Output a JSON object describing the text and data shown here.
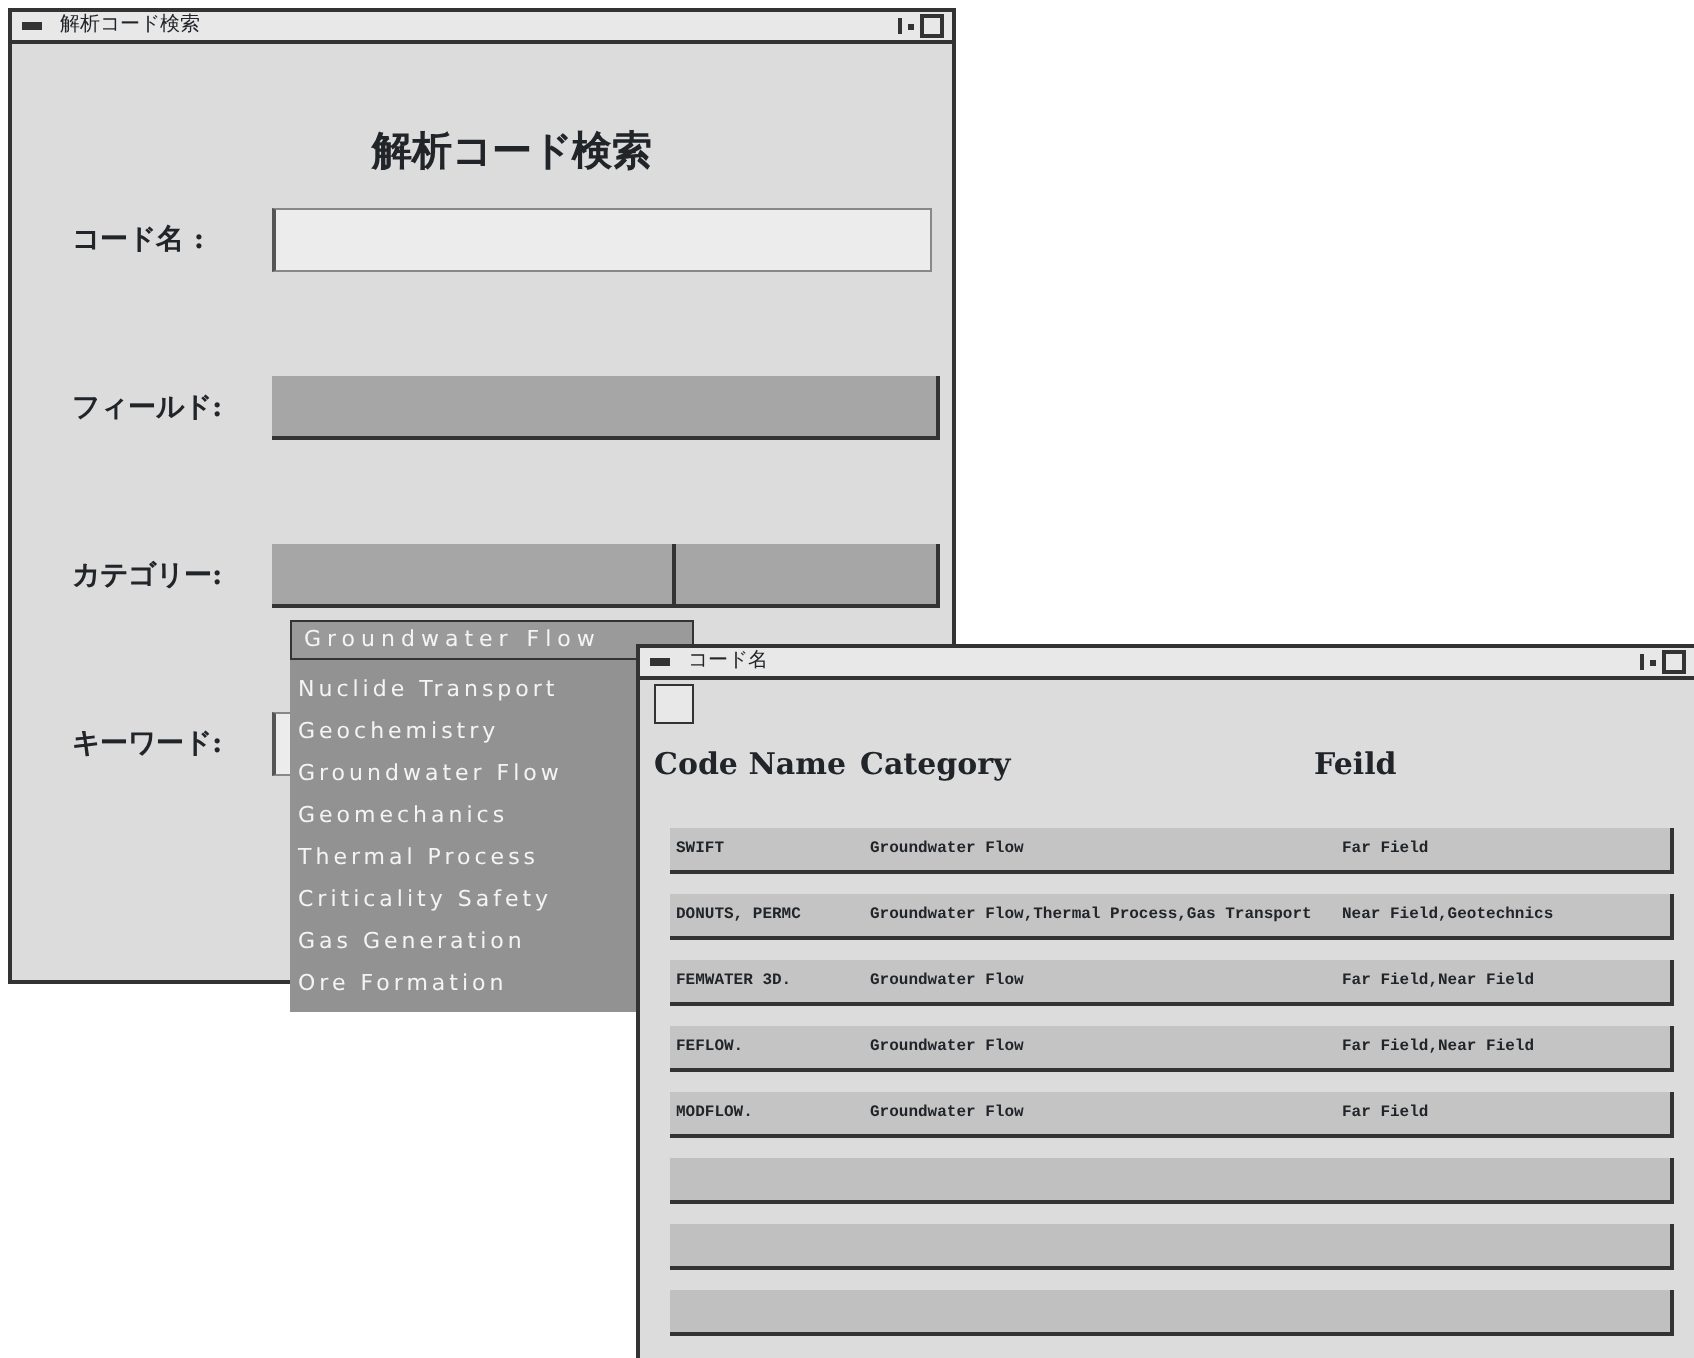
{
  "search_window": {
    "title": "解析コード検索",
    "heading": "解析コード検索",
    "fields": [
      {
        "label": "コード名 :",
        "kind": "text"
      },
      {
        "label": "フィールド:",
        "kind": "select"
      },
      {
        "label": "カテゴリー:",
        "kind": "split"
      },
      {
        "label": "キーワード:",
        "kind": "text"
      }
    ],
    "category_dropdown": {
      "header": "Groundwater Flow",
      "items": [
        "Nuclide Transport",
        "Geochemistry",
        "Groundwater Flow",
        "Geomechanics",
        "Thermal Process",
        "Criticality Safety",
        "Gas Generation",
        "Ore Formation"
      ]
    }
  },
  "result_window": {
    "title": "コード名",
    "select_all": {
      "checked": false
    },
    "columns": [
      "Code Name",
      "Category",
      "Feild"
    ],
    "rows": [
      {
        "kind": "filled",
        "cells": [
          "SWIFT",
          "Groundwater Flow",
          "Far Field"
        ]
      },
      {
        "kind": "filled",
        "cells": [
          "DONUTS, PERMC",
          "Groundwater Flow,Thermal Process,Gas Transport",
          "Near Field,Geotechnics"
        ]
      },
      {
        "kind": "filled",
        "cells": [
          "FEMWATER 3D.",
          "Groundwater Flow",
          "Far Field,Near Field"
        ]
      },
      {
        "kind": "filled",
        "cells": [
          "FEFLOW.",
          "Groundwater Flow",
          "Far Field,Near Field"
        ]
      },
      {
        "kind": "filled",
        "cells": [
          "MODFLOW.",
          "Groundwater Flow",
          "Far Field"
        ]
      },
      {
        "kind": "empty"
      },
      {
        "kind": "empty"
      },
      {
        "kind": "empty"
      }
    ]
  }
}
